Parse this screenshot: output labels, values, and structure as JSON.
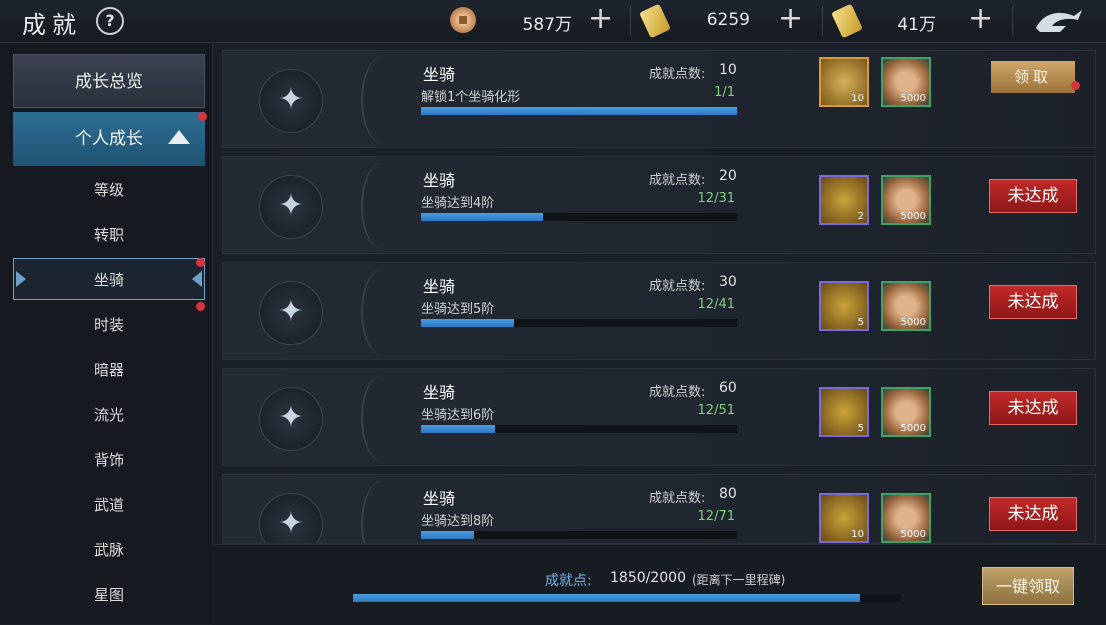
{
  "header": {
    "title": "成就",
    "help_symbol": "?",
    "currencies": [
      {
        "icon": "copper-coin-icon",
        "value": "587万"
      },
      {
        "icon": "gold-ingot-icon",
        "value": "6259"
      },
      {
        "icon": "gold-bar-icon",
        "value": "41万"
      }
    ],
    "plus_symbol": "+",
    "logo_icon": "dragon-logo-icon"
  },
  "sidebar": {
    "overview": "成长总览",
    "personal": "个人成长",
    "items": [
      "等级",
      "转职",
      "坐骑",
      "时装",
      "暗器",
      "流光",
      "背饰",
      "武道",
      "武脉",
      "星图"
    ],
    "active_index": 2
  },
  "achievements": [
    {
      "title": "坐骑",
      "points_label": "成就点数:",
      "points": "10",
      "desc": "解锁1个坐骑化形",
      "progress_text": "1/1",
      "progress": 1.0,
      "rewards": [
        {
          "icon": "gold-ingot-icon",
          "count": "10"
        },
        {
          "icon": "copper-coin-icon",
          "count": "5000"
        }
      ],
      "button": "领取",
      "state": "claimable"
    },
    {
      "title": "坐骑",
      "points_label": "成就点数:",
      "points": "20",
      "desc": "坐骑达到4阶",
      "progress_text": "12/31",
      "progress": 0.387,
      "rewards": [
        {
          "icon": "gold-pouch-icon",
          "count": "2"
        },
        {
          "icon": "copper-coin-icon",
          "count": "5000"
        }
      ],
      "button": "未达成",
      "state": "unmet"
    },
    {
      "title": "坐骑",
      "points_label": "成就点数:",
      "points": "30",
      "desc": "坐骑达到5阶",
      "progress_text": "12/41",
      "progress": 0.293,
      "rewards": [
        {
          "icon": "gold-pouch-icon",
          "count": "5"
        },
        {
          "icon": "copper-coin-icon",
          "count": "5000"
        }
      ],
      "button": "未达成",
      "state": "unmet"
    },
    {
      "title": "坐骑",
      "points_label": "成就点数:",
      "points": "60",
      "desc": "坐骑达到6阶",
      "progress_text": "12/51",
      "progress": 0.235,
      "rewards": [
        {
          "icon": "gold-pouch-icon",
          "count": "5"
        },
        {
          "icon": "copper-coin-icon",
          "count": "5000"
        }
      ],
      "button": "未达成",
      "state": "unmet"
    },
    {
      "title": "坐骑",
      "points_label": "成就点数:",
      "points": "80",
      "desc": "坐骑达到8阶",
      "progress_text": "12/71",
      "progress": 0.169,
      "rewards": [
        {
          "icon": "gold-pouch-icon",
          "count": "10"
        },
        {
          "icon": "copper-coin-icon",
          "count": "5000"
        }
      ],
      "button": "未达成",
      "state": "unmet"
    }
  ],
  "footer": {
    "label": "成就点:",
    "value": "1850/2000",
    "note": "(距离下一里程碑)",
    "progress": 0.925,
    "claim_all": "一键领取"
  },
  "colors": {
    "accent_blue": "#2b78c4",
    "claim": "#b78c52",
    "unmet": "#c22a2a",
    "progress_text": "#7fd07f",
    "badge_red": "#d8333d"
  }
}
